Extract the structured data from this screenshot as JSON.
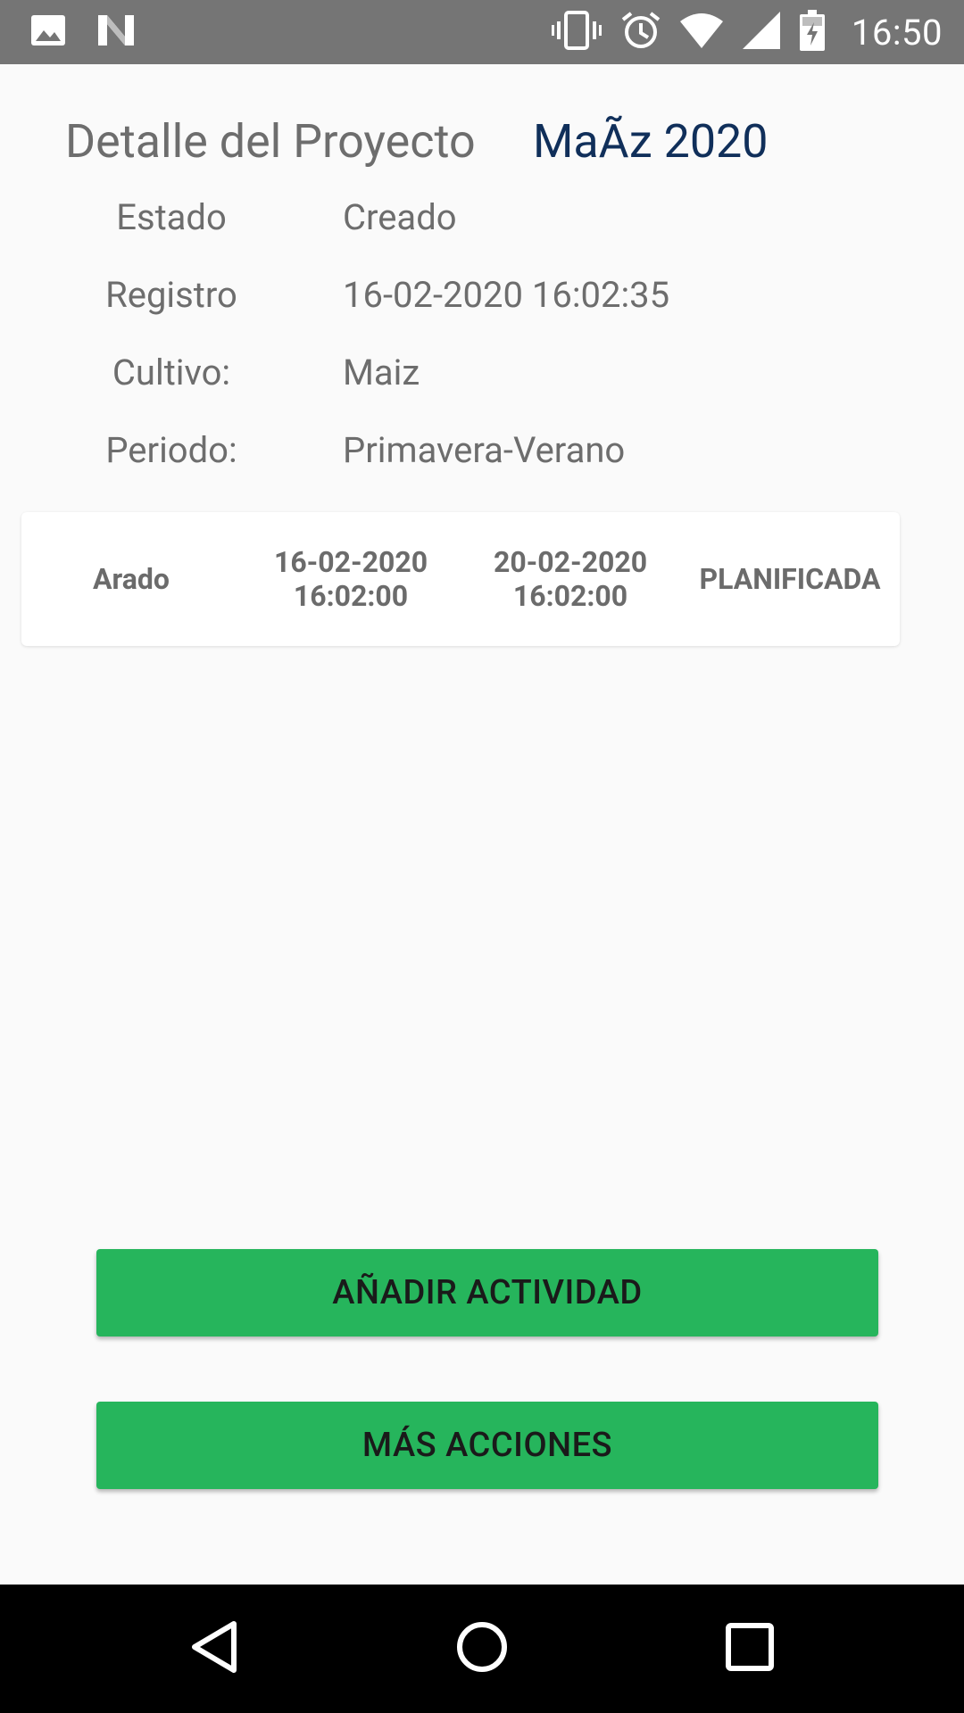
{
  "status_bar": {
    "time": "16:50",
    "left_icons": [
      "image-icon",
      "n-app-icon"
    ],
    "right_icons": [
      "vibrate-icon",
      "alarm-icon",
      "wifi-icon",
      "signal-icon",
      "battery-charging-icon"
    ]
  },
  "header": {
    "title": "Detalle del Proyecto",
    "project_name": "MaÃz 2020"
  },
  "details": [
    {
      "label": "Estado",
      "value": "Creado"
    },
    {
      "label": "Registro",
      "value": "16-02-2020 16:02:35"
    },
    {
      "label": "Cultivo:",
      "value": "Maiz"
    },
    {
      "label": "Periodo:",
      "value": "Primavera-Verano"
    }
  ],
  "activities": [
    {
      "name": "Arado",
      "start_date": "16-02-2020",
      "start_time": "16:02:00",
      "end_date": "20-02-2020",
      "end_time": "16:02:00",
      "status": "PLANIFICADA"
    }
  ],
  "buttons": {
    "add_activity": "AÑADIR ACTIVIDAD",
    "more_actions": "MÁS ACCIONES"
  },
  "colors": {
    "status_bar": "#757575",
    "accent_button": "#26b55c",
    "project_name": "#102f5a",
    "text_gray": "#6d6d6d",
    "nav_bar": "#000000"
  },
  "nav_bar": {
    "icons": [
      "back-icon",
      "home-icon",
      "recents-icon"
    ]
  }
}
